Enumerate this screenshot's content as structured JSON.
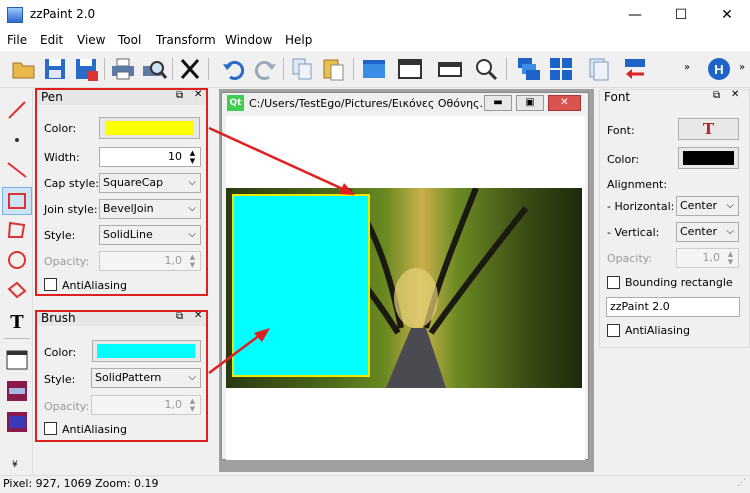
{
  "window": {
    "title": "zzPaint 2.0",
    "minimize": "—",
    "maximize": "☐",
    "close": "✕"
  },
  "menu": [
    "File",
    "Edit",
    "View",
    "Tool",
    "Transform",
    "Window",
    "Help"
  ],
  "pen": {
    "title": "Pen",
    "color_label": "Color:",
    "color": "#ffff00",
    "width_label": "Width:",
    "width": "10",
    "cap_label": "Cap style:",
    "cap": "SquareCap",
    "join_label": "Join style:",
    "join": "BevelJoin",
    "style_label": "Style:",
    "style": "SolidLine",
    "opacity_label": "Opacity:",
    "opacity": "1,0",
    "aa_label": "AntiAliasing"
  },
  "brush": {
    "title": "Brush",
    "color_label": "Color:",
    "color": "#00ffff",
    "style_label": "Style:",
    "style": "SolidPattern",
    "opacity_label": "Opacity:",
    "opacity": "1,0",
    "aa_label": "AntiAliasing"
  },
  "subwindow": {
    "title": "C:/Users/TestEgo/Pictures/Εικόνες Οθόνης...",
    "qt_badge": "Qt"
  },
  "font": {
    "title": "Font",
    "font_label": "Font:",
    "color_label": "Color:",
    "color": "#000000",
    "alignment_label": "Alignment:",
    "horizontal_label": "- Horizontal:",
    "horizontal": "Center",
    "vertical_label": "- Vertical:",
    "vertical": "Center",
    "opacity_label": "Opacity:",
    "opacity": "1,0",
    "bounding_label": "Bounding rectangle",
    "text_value": "zzPaint 2.0",
    "aa_label": "AntiAliasing"
  },
  "status": {
    "text": "Pixel: 927, 1069  Zoom: 0.19"
  },
  "colors": {
    "annotation_red": "#e02020",
    "accent_blue": "#1e64c8"
  },
  "icons": [
    "open-icon",
    "save-icon",
    "save-as-icon",
    "print-icon",
    "print-preview-icon",
    "cut-icon",
    "undo-icon",
    "redo-icon",
    "copy-icon",
    "paste-icon",
    "window-icon",
    "window-menu-icon",
    "window-small-icon",
    "zoom-icon",
    "cascade-icon",
    "tile-icon",
    "pages-icon",
    "exit-icon",
    "help-icon"
  ]
}
